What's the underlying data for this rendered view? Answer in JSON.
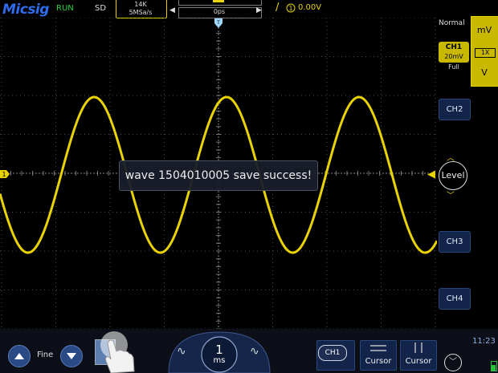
{
  "header": {
    "logo": "Micsig",
    "run_state": "RUN",
    "mode": "SD",
    "memory_depth": "14K",
    "sample_rate": "5MSa/s",
    "horizontal_position": "0ps",
    "trigger_level": "0.00V",
    "trigger_edge": "/",
    "trigger_icon": "trigger-source-icon"
  },
  "right_panel": {
    "trigger_mode": "Normal",
    "vertical_unit_top": "mV",
    "probe": "1X",
    "vertical_unit_bottom": "V",
    "ch1": {
      "name": "CH1",
      "scale": "20mV",
      "bandwidth": "Full"
    },
    "channels": [
      "CH2",
      "CH3",
      "CH4"
    ],
    "level_label": "Level"
  },
  "message": "wave 1504010005 save success!",
  "bottom": {
    "fine_label": "Fine",
    "timebase_value": "1",
    "timebase_unit": "ms",
    "source_label": "CH1",
    "cursor_h_label": "Cursor",
    "cursor_v_label": "Cursor",
    "time": "11:23"
  },
  "colors": {
    "ch1": "#e8d200",
    "run": "#25d23a",
    "button_blue": "#12244a",
    "logo": "#2f6df0"
  },
  "waveform": {
    "channel": "CH1",
    "shape": "sine",
    "cycles_on_screen": 3.3
  }
}
